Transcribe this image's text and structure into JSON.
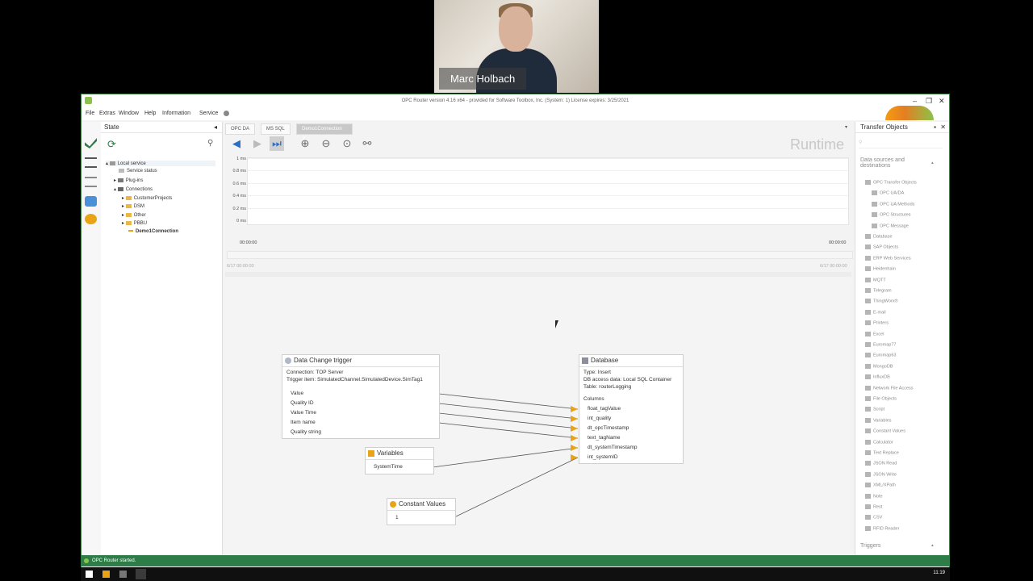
{
  "webcam": {
    "name": "Marc Holbach"
  },
  "window": {
    "title": "OPC Router version 4.16 x64 - provided for Software Toolbox, Inc. (System: 1) License expires: 3/25/2021",
    "menu": [
      "File",
      "Extras",
      "Window",
      "Help",
      "Information",
      "Service"
    ]
  },
  "state_panel": {
    "title": "State",
    "tree": {
      "local_service": "Local service",
      "service_status": "Service status",
      "plugins": "Plug-ins",
      "connections": "Connections",
      "folders": [
        "CustomerProjects",
        "DSM",
        "Other",
        "PBBU"
      ],
      "selected": "Demo1Connection"
    }
  },
  "tabs": [
    "OPC DA",
    "MS SQL",
    "Demo1Connection"
  ],
  "runtime_label": "Runtime",
  "chart_data": {
    "type": "line",
    "yticks": [
      "1 ms",
      "0.8 ms",
      "0.6 ms",
      "0.4 ms",
      "0.2 ms",
      "0 ms"
    ],
    "xticks": [
      "00:00:00",
      "00:00:00"
    ],
    "range_labels": [
      "6/17 00:00:00",
      "6/17 00:00:00"
    ],
    "series": []
  },
  "nodes": {
    "trigger": {
      "title": "Data Change trigger",
      "connection": "Connection: TOP Server",
      "trigger_item": "Trigger item: SimulatedChannel.SimulatedDevice.SimTag1",
      "outputs": [
        "Value",
        "Quality ID",
        "Value Time",
        "Item name",
        "Quality string"
      ]
    },
    "variables": {
      "title": "Variables",
      "items": [
        "SystemTime"
      ]
    },
    "constants": {
      "title": "Constant Values",
      "items": [
        "1"
      ]
    },
    "database": {
      "title": "Database",
      "type": "Type: Insert",
      "access": "DB access data: Local SQL Container",
      "table": "Table: routerLogging",
      "columns_label": "Columns",
      "columns": [
        "float_tagValue",
        "int_quality",
        "dt_opcTimestamp",
        "text_tagName",
        "dt_systemTimestamp",
        "int_systemID"
      ]
    }
  },
  "transfer_panel": {
    "title": "Transfer Objects",
    "section": "Data sources and destinations",
    "items": [
      "OPC Transfer Objects",
      "OPC UA/DA",
      "OPC UA Methods",
      "OPC Structures",
      "OPC Message",
      "Database",
      "SAP Objects",
      "ERP Web Services",
      "Heidenhain",
      "MQTT",
      "Telegram",
      "ThingWorx®",
      "E-mail",
      "Printers",
      "Excel",
      "Euromap77",
      "Euromap63",
      "MongoDB",
      "InfluxDB",
      "Network File Access",
      "File Objects",
      "Script",
      "Variables",
      "Constant Values",
      "Calculator",
      "Text Replace",
      "JSON Read",
      "JSON Write",
      "XML/XPath",
      "Note",
      "Rest",
      "CSV",
      "RFID Reader"
    ],
    "triggers": "Triggers"
  },
  "status": {
    "text": "OPC Router started."
  },
  "taskbar": {
    "time": "11:19"
  }
}
